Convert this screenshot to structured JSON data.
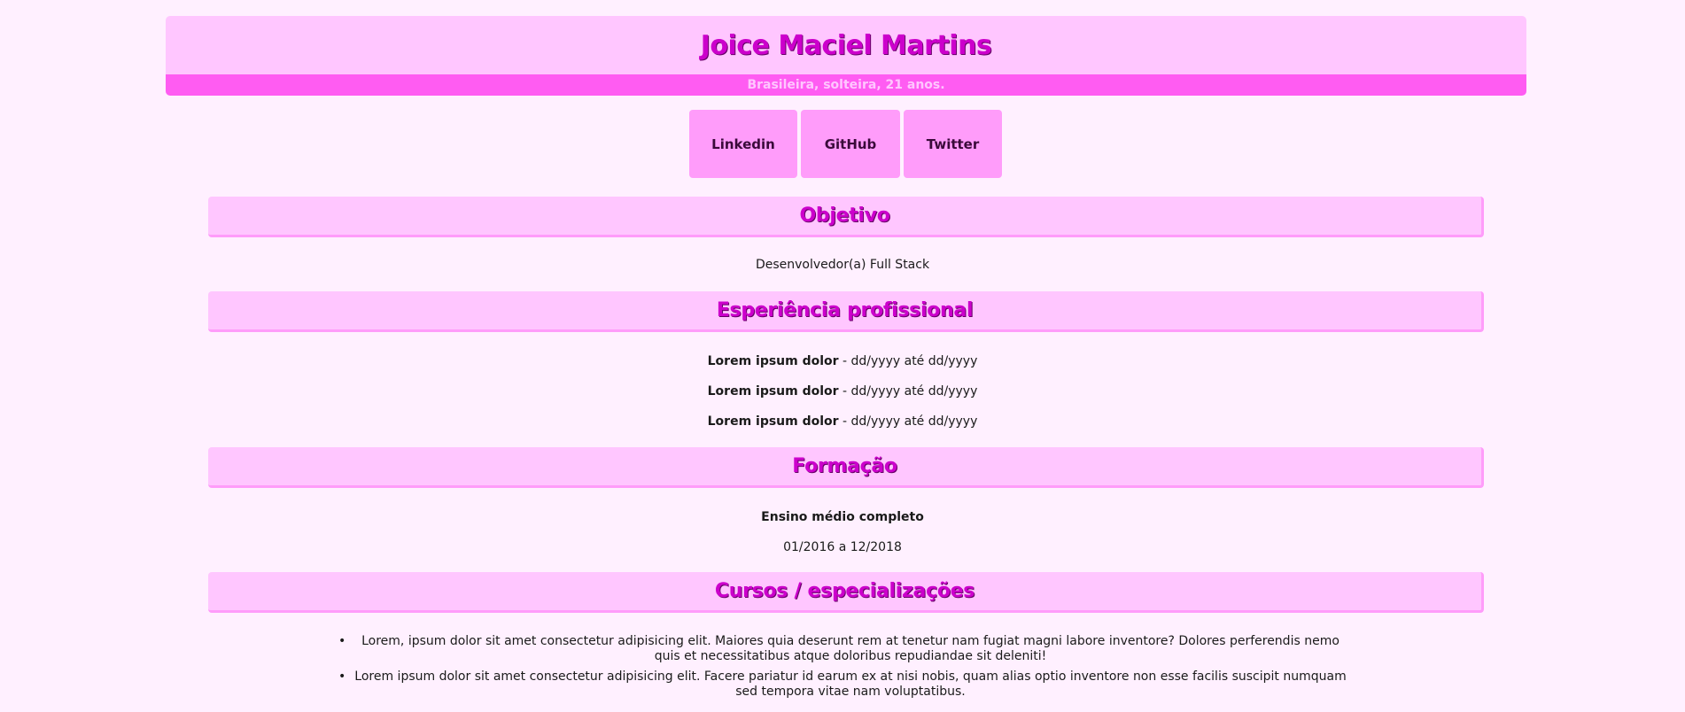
{
  "header": {
    "name": "Joice Maciel Martins",
    "subtitle": "Brasileira, solteira, 21 anos."
  },
  "links": [
    {
      "label": "Linkedin",
      "icon": "linkedin-link"
    },
    {
      "label": "GitHub",
      "icon": "github-link"
    },
    {
      "label": "Twitter",
      "icon": "twitter-link"
    }
  ],
  "sections": {
    "objetivo": {
      "title": "Objetivo",
      "text": "Desenvolvedor(a) Full Stack"
    },
    "experiencia": {
      "title": "Esperiência profissional",
      "items": [
        {
          "company": "Lorem ipsum dolor",
          "period": " - dd/yyyy até dd/yyyy"
        },
        {
          "company": "Lorem ipsum dolor",
          "period": " - dd/yyyy até dd/yyyy"
        },
        {
          "company": "Lorem ipsum dolor",
          "period": " - dd/yyyy até dd/yyyy"
        }
      ]
    },
    "formacao": {
      "title": "Formação",
      "degree": "Ensino médio completo",
      "period": "01/2016 a 12/2018"
    },
    "cursos": {
      "title": "Cursos / especializações",
      "items": [
        "Lorem, ipsum dolor sit amet consectetur adipisicing elit. Maiores quia deserunt rem at tenetur nam fugiat magni labore inventore? Dolores perferendis nemo quis et necessitatibus atque doloribus repudiandae sit deleniti!",
        "Lorem ipsum dolor sit amet consectetur adipisicing elit. Facere pariatur id earum ex at nisi nobis, quam alias optio inventore non esse facilis suscipit numquam sed tempora vitae nam voluptatibus."
      ]
    }
  },
  "colors": {
    "background": "#fff0ff",
    "header_bg": "#ffc6ff",
    "subbar_bg": "#ff5cf2",
    "button_bg": "#ff9cfa",
    "title_color": "#cc00cc"
  }
}
